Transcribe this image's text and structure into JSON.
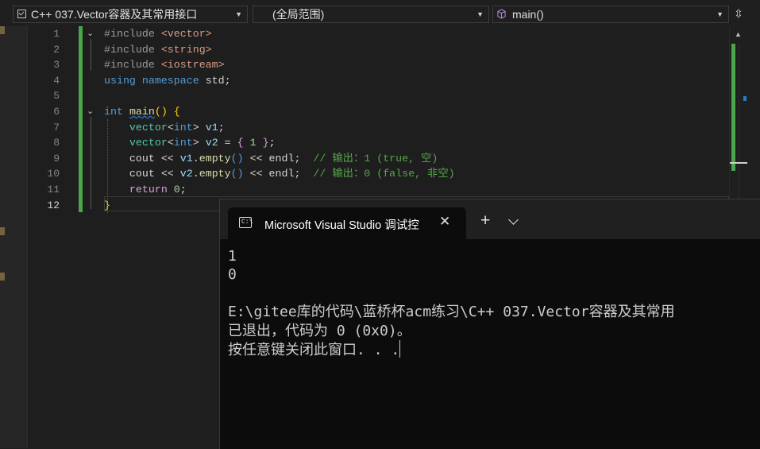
{
  "navbar": {
    "project": "C++ 037.Vector容器及其常用接口",
    "scope": "(全局范围)",
    "member": "main()"
  },
  "editor": {
    "line_numbers": [
      "1",
      "2",
      "3",
      "4",
      "5",
      "6",
      "7",
      "8",
      "9",
      "10",
      "11",
      "12"
    ],
    "current_line": "12"
  },
  "console": {
    "tab_icon_text": "C:\\",
    "tab_title": "Microsoft Visual Studio 调试控",
    "lines": [
      "1",
      "0",
      "",
      "E:\\gitee库的代码\\蓝桥杯acm练习\\C++ 037.Vector容器及其常用",
      "已退出，代码为 0 (0x0)。",
      "按任意键关闭此窗口. . ."
    ]
  },
  "colors": {
    "editor_bg": "#1e1e1e",
    "change_bar": "#4aa64a",
    "console_bg": "#0c0c0c",
    "keyword": "#569cd6",
    "comment": "#57a64a"
  },
  "icons": [
    "cube-icon",
    "split-view-icon",
    "terminal-icon",
    "close-icon",
    "plus-icon",
    "chevron-down-icon"
  ]
}
